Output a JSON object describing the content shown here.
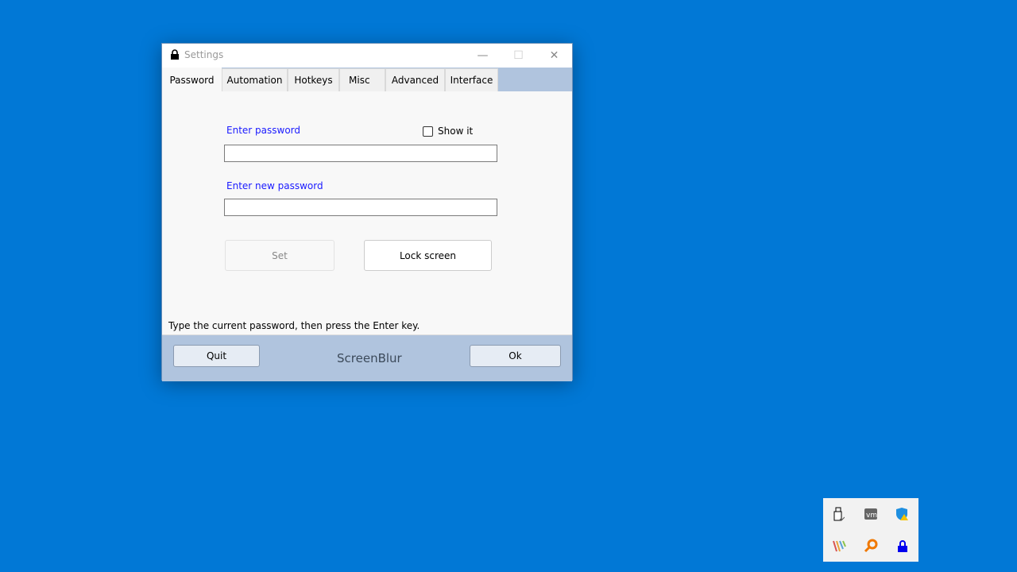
{
  "window": {
    "title": "Settings",
    "minimize": "—",
    "maximize": "☐",
    "close": "✕"
  },
  "tabs": [
    {
      "label": "Password",
      "active": true
    },
    {
      "label": "Automation"
    },
    {
      "label": "Hotkeys"
    },
    {
      "label": "Misc"
    },
    {
      "label": "Advanced"
    },
    {
      "label": "Interface"
    }
  ],
  "password": {
    "enter_label": "Enter password",
    "show_it": "Show it",
    "show_it_checked": false,
    "password_value": "",
    "new_label": "Enter new password",
    "new_value": "",
    "set_label": "Set",
    "lock_label": "Lock screen"
  },
  "hint": "Type the current password, then press the Enter key.",
  "footer": {
    "quit": "Quit",
    "brand": "ScreenBlur",
    "ok": "Ok"
  },
  "colors": {
    "desktop": "#0178d6",
    "label": "#1a1aff",
    "footer": "#b0c4de"
  },
  "tray": [
    "usb-drive-icon",
    "vmware-icon",
    "defender-warning-icon",
    "colorful-stripes-icon",
    "search-key-icon",
    "lock-icon"
  ]
}
